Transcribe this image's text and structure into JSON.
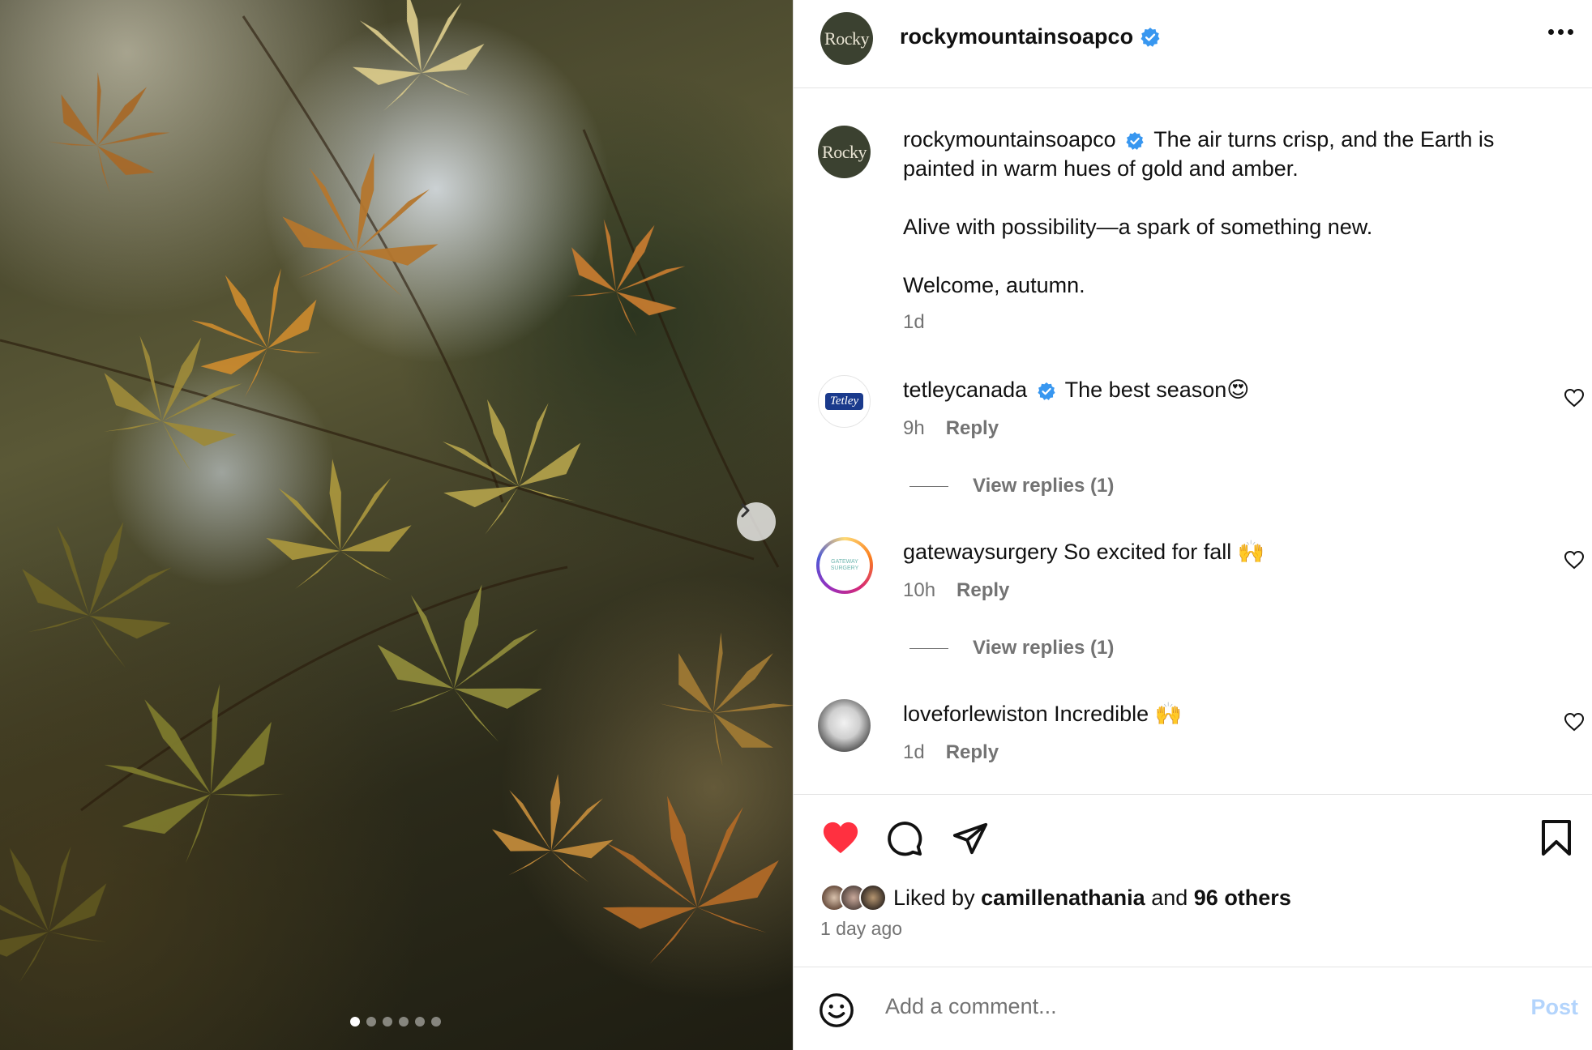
{
  "post": {
    "username": "rockymountainsoapco",
    "avatar_text": "Rocky",
    "caption_lines": [
      "The air turns crisp, and the Earth is painted in warm hues of gold and amber.",
      "Alive with possibility—a spark of something new.",
      "Welcome, autumn."
    ],
    "caption_age": "1d",
    "carousel_count": 6,
    "carousel_active_index": 0
  },
  "comments": [
    {
      "username": "tetleycanada",
      "verified": true,
      "text": "The best season😍",
      "age": "9h",
      "reply_label": "Reply",
      "view_replies": "View replies (1)",
      "avatar_text": "Tetley"
    },
    {
      "username": "gatewaysurgery",
      "verified": false,
      "text": "So excited for fall 🙌",
      "age": "10h",
      "reply_label": "Reply",
      "view_replies": "View replies (1)",
      "avatar_text": "GATEWAY SURGERY"
    },
    {
      "username": "loveforlewiston",
      "verified": false,
      "text": "Incredible 🙌",
      "age": "1d",
      "reply_label": "Reply"
    }
  ],
  "likes": {
    "prefix": "Liked by",
    "first_liker": "camillenathania",
    "and": "and",
    "others": "96 others",
    "posted": "1 day ago"
  },
  "composer": {
    "placeholder": "Add a comment...",
    "post_label": "Post"
  },
  "colors": {
    "verified": "#3897f0",
    "like_red": "#ff3040",
    "post_disabled": "#b3d4fc",
    "avatar_green": "#3b4130"
  },
  "icons": [
    "chevron-right-icon",
    "more-icon",
    "verified-icon",
    "heart-icon",
    "comment-icon",
    "share-icon",
    "bookmark-icon",
    "emoji-icon"
  ]
}
